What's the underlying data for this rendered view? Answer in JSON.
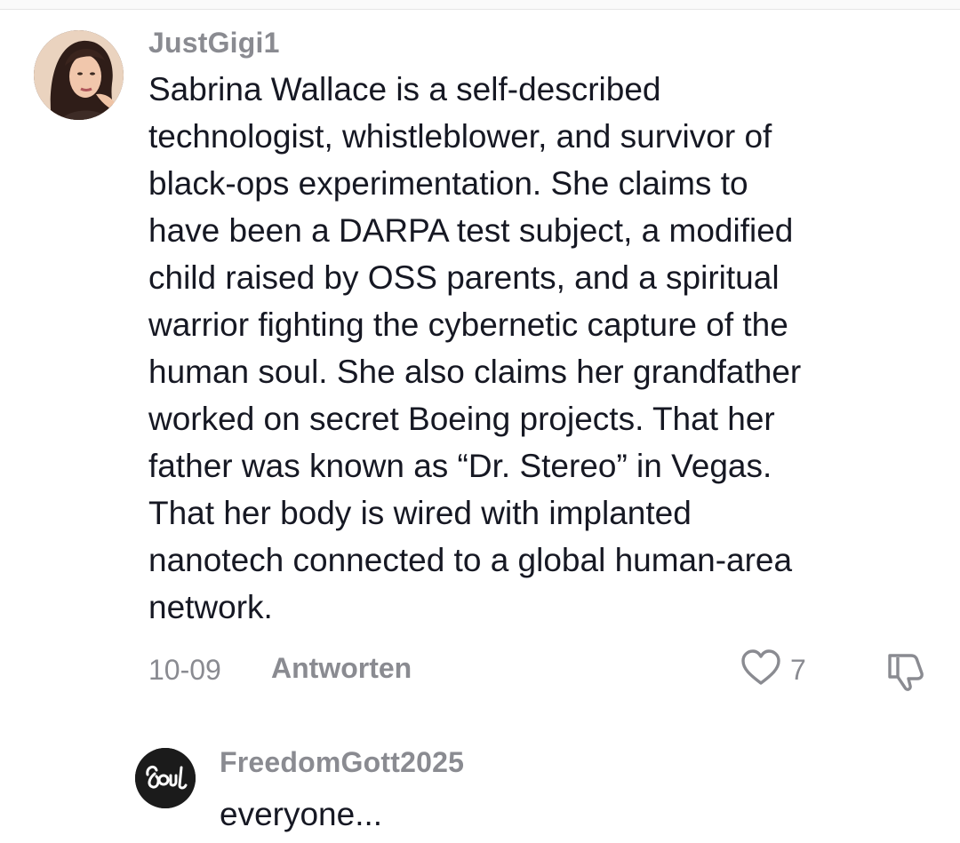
{
  "comments": [
    {
      "username": "JustGigi1",
      "avatar_icon": "profile-photo",
      "text": "Sabrina Wallace is a self-described\ntechnologist, whistleblower, and survivor of\nblack-ops experimentation. She claims to\nhave been a DARPA test subject, a modified\nchild raised by OSS parents, and a spiritual\nwarrior fighting the cybernetic capture of the\nhuman soul. She also claims her grandfather\nworked on secret Boeing projects. That her\nfather was known as “Dr. Stereo” in Vegas.\nThat her body is wired with implanted\nnanotech connected to a global human-area\nnetwork.",
      "date": "10-09",
      "reply_label": "Antworten",
      "like_count": "7",
      "like_icon": "heart-icon",
      "dislike_icon": "thumbs-down-icon"
    },
    {
      "username": "FreedomGott2025",
      "avatar_logo_text": "Soul",
      "text": "everyone..."
    }
  ],
  "colors": {
    "text_primary": "#161823",
    "text_secondary": "#8a8b91",
    "background": "#ffffff"
  }
}
